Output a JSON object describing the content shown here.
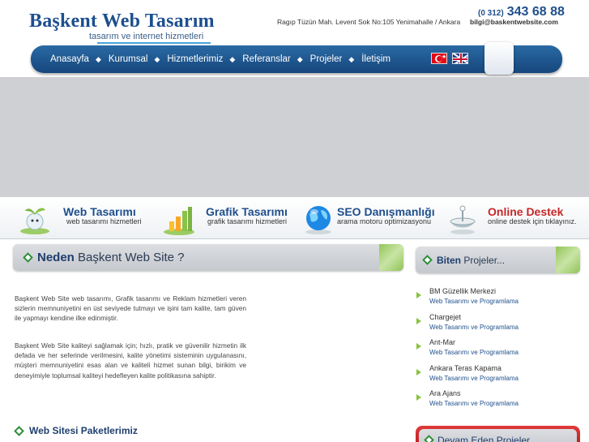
{
  "header": {
    "logo_title": "Başkent Web Tasarım",
    "logo_subtitle": "tasarım ve internet hizmetleri",
    "address": "Ragıp Tüzün Mah. Levent Sok No:105 Yenimahalle / Ankara",
    "phone_code": "(0 312)",
    "phone_number": "343 68 88",
    "email": "bilgi@baskentwebsite.com"
  },
  "nav": {
    "items": [
      "Anasayfa",
      "Kurumsal",
      "Hizmetlerimiz",
      "Referanslar",
      "Projeler",
      "İletişim"
    ],
    "separator": "◆"
  },
  "services": [
    {
      "title": "Web Tasarımı",
      "subtitle": "web tasarımı hizmetleri",
      "color": "#1f4f8c"
    },
    {
      "title": "Grafik Tasarımı",
      "subtitle": "grafik tasarımı hizmetleri",
      "color": "#1f4f8c"
    },
    {
      "title": "SEO Danışmanlığı",
      "subtitle": "arama motoru optimizasyonu",
      "color": "#1f4f8c"
    },
    {
      "title": "Online Destek",
      "subtitle": "online destek için tıklayınız.",
      "color": "#c62828"
    }
  ],
  "why": {
    "title_bold": "Neden",
    "title_rest": "Başkent Web Site ?",
    "para1": "Başkent Web Site web tasarımı, Grafik tasarımı ve Reklam hizmetleri veren sizlerin memnuniyetini en üst seviyede tutmayı ve işini tam kalite, tam güven ile yapmayı kendine ilke edinmiştir.",
    "para2": "Başkent Web Site kaliteyi sağlamak için; hızlı, pratik ve güvenilir hizmetin ilk defada ve her seferinde verilmesini, kalite yönetimi sisteminin uygulanasını, müşteri memnuniyetini esas alan ve kaliteli hizmet sunan bilgi, birikim ve deneyimiyle toplumsal kaliteyi hedefleyen kalite politikasına sahiptir."
  },
  "finished": {
    "title_bold": "Biten",
    "title_rest": "Projeler...",
    "items": [
      {
        "name": "BM Güzellik Merkezi",
        "category": "Web Tasarımı ve Programlama"
      },
      {
        "name": "Chargejet",
        "category": "Web Tasarımı ve Programlama"
      },
      {
        "name": "Ant-Mar",
        "category": "Web Tasarımı ve Programlama"
      },
      {
        "name": "Ankara Teras Kapama",
        "category": "Web Tasarımı ve Programlama"
      },
      {
        "name": "Ara Ajans",
        "category": "Web Tasarımı ve Programlama"
      }
    ]
  },
  "packages": {
    "title": "Web Sitesi Paketlerimiz"
  },
  "ongoing": {
    "title": "Devam Eden Projeler"
  }
}
